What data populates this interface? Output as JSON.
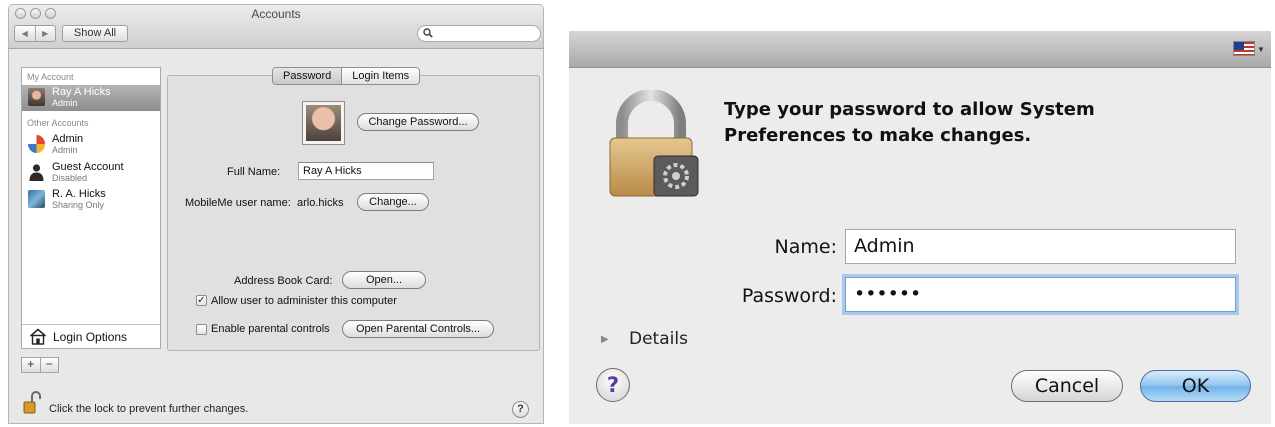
{
  "accounts_window": {
    "title": "Accounts",
    "toolbar": {
      "back_glyph": "◀",
      "forward_glyph": "▶",
      "show_all_label": "Show All",
      "search_icon": "search-icon",
      "search_value": ""
    },
    "sidebar": {
      "my_account_header": "My Account",
      "my_account": {
        "name": "Ray A Hicks",
        "role": "Admin",
        "selected": true
      },
      "other_accounts_header": "Other Accounts",
      "other_accounts": [
        {
          "name": "Admin",
          "role": "Admin"
        },
        {
          "name": "Guest Account",
          "role": "Disabled"
        },
        {
          "name": "R. A. Hicks",
          "role": "Sharing Only"
        }
      ],
      "login_options_label": "Login Options",
      "add_label": "+",
      "remove_label": "−"
    },
    "tabs": [
      {
        "label": "Password",
        "active": true
      },
      {
        "label": "Login Items",
        "active": false
      }
    ],
    "detail": {
      "change_password_label": "Change Password...",
      "full_name_label": "Full Name:",
      "full_name_value": "Ray A Hicks",
      "mobileme_label": "MobileMe user name:",
      "mobileme_value": "arlo.hicks",
      "mobileme_change_label": "Change...",
      "address_book_label": "Address Book Card:",
      "address_book_open_label": "Open...",
      "allow_admin_label": "Allow user to administer this computer",
      "allow_admin_checked": true,
      "parental_label": "Enable parental controls",
      "parental_checked": false,
      "open_parental_label": "Open Parental Controls..."
    },
    "footer": {
      "lock_text": "Click the lock to prevent further changes.",
      "help_glyph": "?"
    }
  },
  "auth_dialog": {
    "input_source_flag": "us-flag-icon",
    "prompt": "Type your password to allow System Preferences to make changes.",
    "name_label": "Name:",
    "name_value": "Admin",
    "password_label": "Password:",
    "password_value": "••••••",
    "details_label": "Details",
    "help_glyph": "?",
    "cancel_label": "Cancel",
    "ok_label": "OK"
  }
}
